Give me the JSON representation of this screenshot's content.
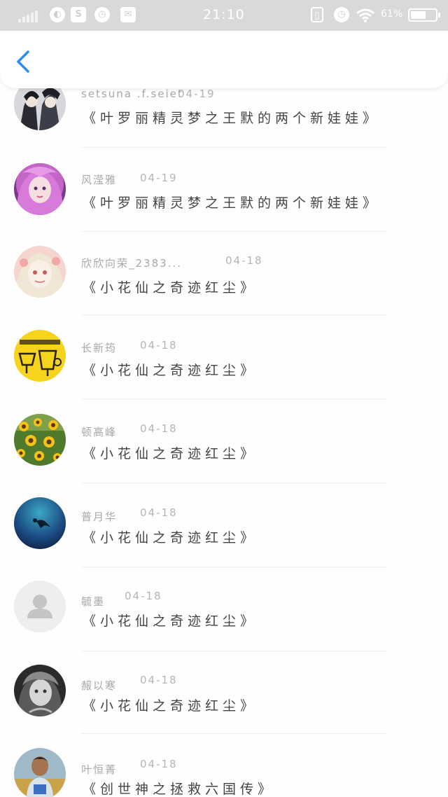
{
  "status_bar": {
    "time": "21:10",
    "battery_text": "61%",
    "battery_level": 0.61,
    "icons": [
      "signal-icon",
      "app-icon",
      "s-icon",
      "alarm-icon",
      "mail-icon",
      "vibrate-icon",
      "alarm-icon",
      "wifi-icon",
      "battery-icon"
    ]
  },
  "nav_bar": {
    "back_icon": "chevron-left-icon",
    "accent_color": "#2f8cf0"
  },
  "list": {
    "items": [
      {
        "name": "setsuna .f.seiet",
        "date": "04-19",
        "title": "《叶罗丽精灵梦之王默的两个新娃娃》",
        "avatar": "anime-characters"
      },
      {
        "name": "风滢雅",
        "date": "04-19",
        "title": "《叶罗丽精灵梦之王默的两个新娃娃》",
        "avatar": "pink-hair-doll"
      },
      {
        "name": "欣欣向荣_2383...",
        "date": "04-18",
        "title": "《小花仙之奇迹红尘》",
        "avatar": "anime-girl"
      },
      {
        "name": "长新筠",
        "date": "04-18",
        "title": "《小花仙之奇迹红尘》",
        "avatar": "yellow-sticker"
      },
      {
        "name": "顿高峰",
        "date": "04-18",
        "title": "《小花仙之奇迹红尘》",
        "avatar": "sunflowers"
      },
      {
        "name": "普月华",
        "date": "04-18",
        "title": "《小花仙之奇迹红尘》",
        "avatar": "underwater-diver"
      },
      {
        "name": "毓墨",
        "date": "04-18",
        "title": "《小花仙之奇迹红尘》",
        "avatar": "default-user"
      },
      {
        "name": "赧以寒",
        "date": "04-18",
        "title": "《小花仙之奇迹红尘》",
        "avatar": "bw-child"
      },
      {
        "name": "叶恒菁",
        "date": "04-18",
        "title": "《创世神之拯救六国传》",
        "avatar": "boy-photo"
      }
    ]
  }
}
